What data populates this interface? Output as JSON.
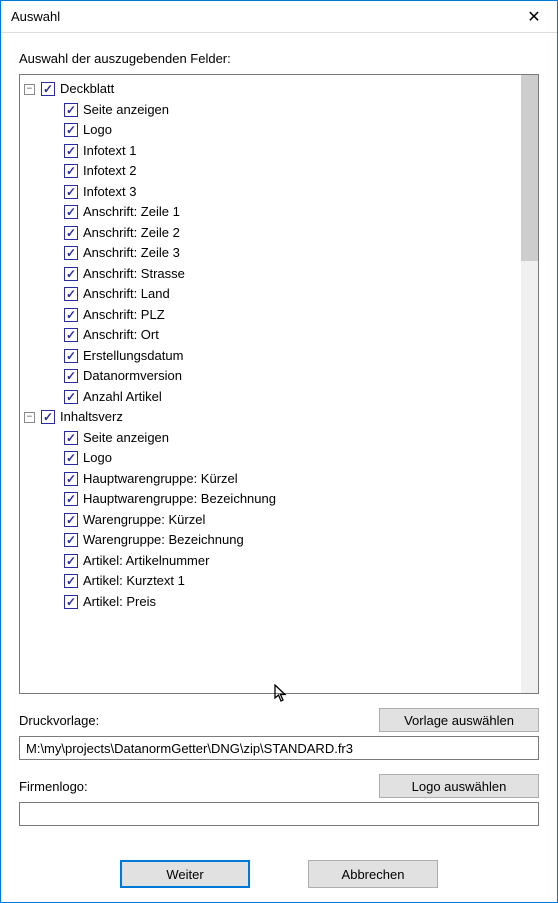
{
  "window": {
    "title": "Auswahl",
    "close_icon": "✕"
  },
  "header_label": "Auswahl der auszugebenden Felder:",
  "tree": {
    "groups": [
      {
        "label": "Deckblatt",
        "checked": true,
        "expanded": true,
        "items": [
          {
            "label": "Seite anzeigen",
            "checked": true
          },
          {
            "label": "Logo",
            "checked": true
          },
          {
            "label": "Infotext 1",
            "checked": true
          },
          {
            "label": "Infotext 2",
            "checked": true
          },
          {
            "label": "Infotext 3",
            "checked": true
          },
          {
            "label": "Anschrift: Zeile 1",
            "checked": true
          },
          {
            "label": "Anschrift: Zeile 2",
            "checked": true
          },
          {
            "label": "Anschrift: Zeile 3",
            "checked": true
          },
          {
            "label": "Anschrift: Strasse",
            "checked": true
          },
          {
            "label": "Anschrift: Land",
            "checked": true
          },
          {
            "label": "Anschrift: PLZ",
            "checked": true
          },
          {
            "label": "Anschrift: Ort",
            "checked": true
          },
          {
            "label": "Erstellungsdatum",
            "checked": true
          },
          {
            "label": "Datanormversion",
            "checked": true
          },
          {
            "label": "Anzahl Artikel",
            "checked": true
          }
        ]
      },
      {
        "label": "Inhaltsverz",
        "checked": true,
        "expanded": true,
        "items": [
          {
            "label": "Seite anzeigen",
            "checked": true
          },
          {
            "label": "Logo",
            "checked": true
          },
          {
            "label": "Hauptwarengruppe: Kürzel",
            "checked": true
          },
          {
            "label": "Hauptwarengruppe: Bezeichnung",
            "checked": true
          },
          {
            "label": "Warengruppe: Kürzel",
            "checked": true
          },
          {
            "label": "Warengruppe: Bezeichnung",
            "checked": true
          },
          {
            "label": "Artikel: Artikelnummer",
            "checked": true
          },
          {
            "label": "Artikel: Kurztext 1",
            "checked": true
          },
          {
            "label": "Artikel: Preis",
            "checked": true
          }
        ]
      }
    ]
  },
  "template_section": {
    "label": "Druckvorlage:",
    "button": "Vorlage auswählen",
    "value": "M:\\my\\projects\\DatanormGetter\\DNG\\zip\\STANDARD.fr3"
  },
  "logo_section": {
    "label": "Firmenlogo:",
    "button": "Logo auswählen",
    "value": ""
  },
  "buttons": {
    "continue": "Weiter",
    "cancel": "Abbrechen"
  },
  "expander_minus": "−"
}
